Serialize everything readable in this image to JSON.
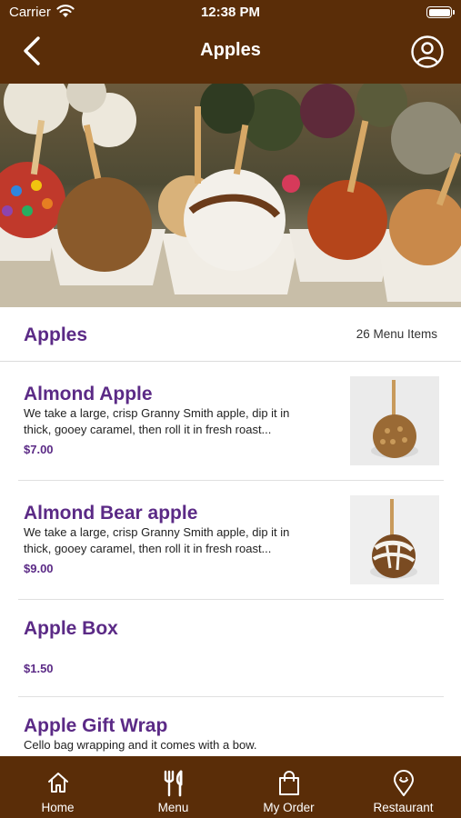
{
  "status_bar": {
    "carrier": "Carrier",
    "time": "12:38 PM"
  },
  "nav": {
    "title": "Apples",
    "back_icon": "chevron-left-icon",
    "profile_icon": "user-circle-icon"
  },
  "hero": {
    "image": "caramel apples photo"
  },
  "section": {
    "title": "Apples",
    "count_label": "26 Menu Items"
  },
  "menu_items": [
    {
      "name": "Almond Apple",
      "description": "We take a large, crisp Granny Smith apple, dip it in thick, gooey caramel, then roll it in fresh roast...",
      "price": "$7.00"
    },
    {
      "name": "Almond Bear apple",
      "description": "We take a large, crisp Granny Smith apple, dip it in thick, gooey caramel, then roll it in fresh roast...",
      "price": "$9.00"
    },
    {
      "name": "Apple Box",
      "description": "",
      "price": "$1.50"
    },
    {
      "name": "Apple Gift Wrap",
      "description": "Cello bag wrapping and it comes with a bow.",
      "price": ""
    }
  ],
  "tabbar": {
    "tabs": [
      {
        "label": "Home",
        "icon": "home-icon"
      },
      {
        "label": "Menu",
        "icon": "fork-knife-icon"
      },
      {
        "label": "My Order",
        "icon": "shopping-bag-icon"
      },
      {
        "label": "Restaurant",
        "icon": "location-pin-icon"
      }
    ]
  },
  "colors": {
    "brand_brown": "#5a2d08",
    "accent_purple": "#5b2a86"
  }
}
